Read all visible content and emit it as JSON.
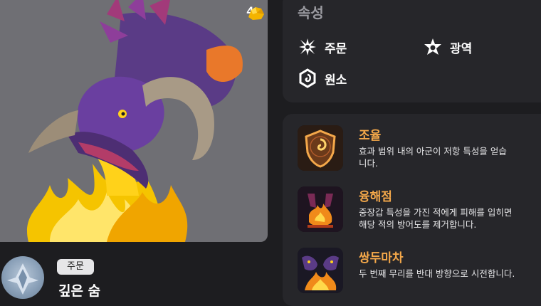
{
  "card": {
    "cost": "4",
    "type_tag": "주문",
    "name": "깊은 숨"
  },
  "attributes": {
    "title": "속성",
    "items": [
      {
        "label": "주문",
        "icon": "spell-burst-icon"
      },
      {
        "label": "광역",
        "icon": "area-star-icon"
      },
      {
        "label": "원소",
        "icon": "element-swirl-icon"
      }
    ]
  },
  "abilities": [
    {
      "name": "조율",
      "desc": "효과 범위 내의 아군이 저항 특성을 얻습\n니다.",
      "icon": "attunement-shield-icon"
    },
    {
      "name": "융해점",
      "desc": "중장갑 특성을 가진 적에게 피해를 입히면\n해당 적의 방어도를 제거합니다.",
      "icon": "melting-point-icon"
    },
    {
      "name": "쌍두마차",
      "desc": "두 번째 무리를 반대 방향으로 시전합니다.",
      "icon": "twin-dragon-icon"
    }
  ],
  "colors": {
    "ability_name": "#f4a84a",
    "panel_bg": "#26262a",
    "page_bg": "#1d1d20"
  }
}
